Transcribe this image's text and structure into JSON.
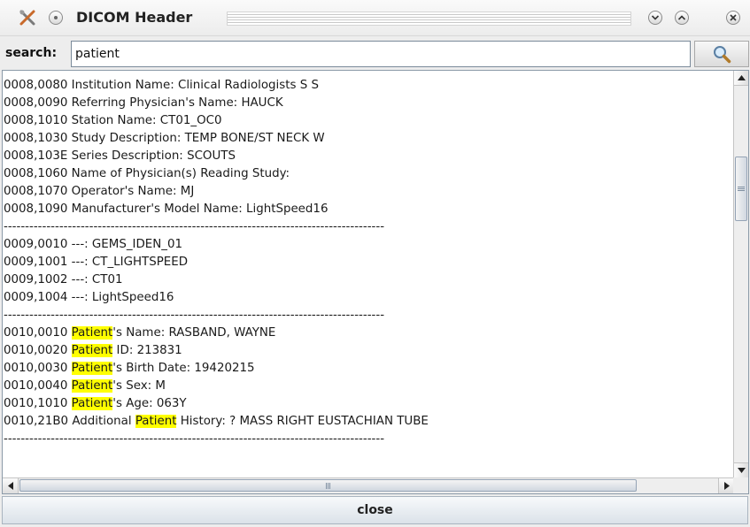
{
  "window": {
    "title": "DICOM Header"
  },
  "search": {
    "label": "search:",
    "value": "patient"
  },
  "content": {
    "highlight_color": "#ffff00",
    "lines": [
      [
        {
          "t": "0008,0080 Institution Name: Clinical Radiologists S S"
        }
      ],
      [
        {
          "t": "0008,0090 Referring Physician's Name: HAUCK"
        }
      ],
      [
        {
          "t": "0008,1010 Station Name: CT01_OC0"
        }
      ],
      [
        {
          "t": "0008,1030 Study Description: TEMP BONE/ST NECK W"
        }
      ],
      [
        {
          "t": "0008,103E Series Description: SCOUTS"
        }
      ],
      [
        {
          "t": "0008,1060 Name of Physician(s) Reading Study:"
        }
      ],
      [
        {
          "t": "0008,1070 Operator's Name: MJ"
        }
      ],
      [
        {
          "t": "0008,1090 Manufacturer's Model Name: LightSpeed16"
        }
      ],
      [
        {
          "t": "-----------------------------------------------------------------------------------------"
        }
      ],
      [
        {
          "t": "0009,0010 ---: GEMS_IDEN_01"
        }
      ],
      [
        {
          "t": "0009,1001 ---: CT_LIGHTSPEED"
        }
      ],
      [
        {
          "t": "0009,1002 ---: CT01"
        }
      ],
      [
        {
          "t": "0009,1004 ---: LightSpeed16"
        }
      ],
      [
        {
          "t": "-----------------------------------------------------------------------------------------"
        }
      ],
      [
        {
          "t": "0010,0010 "
        },
        {
          "t": "Patient",
          "hl": true
        },
        {
          "t": "'s Name: RASBAND, WAYNE"
        }
      ],
      [
        {
          "t": "0010,0020 "
        },
        {
          "t": "Patient",
          "hl": true
        },
        {
          "t": " ID: 213831"
        }
      ],
      [
        {
          "t": "0010,0030 "
        },
        {
          "t": "Patient",
          "hl": true
        },
        {
          "t": "'s Birth Date: 19420215"
        }
      ],
      [
        {
          "t": "0010,0040 "
        },
        {
          "t": "Patient",
          "hl": true
        },
        {
          "t": "'s Sex: M"
        }
      ],
      [
        {
          "t": "0010,1010 "
        },
        {
          "t": "Patient",
          "hl": true
        },
        {
          "t": "'s Age: 063Y"
        }
      ],
      [
        {
          "t": "0010,21B0 Additional "
        },
        {
          "t": "Patient",
          "hl": true
        },
        {
          "t": " History: ? MASS RIGHT EUSTACHIAN TUBE"
        }
      ],
      [
        {
          "t": "-----------------------------------------------------------------------------------------"
        }
      ]
    ]
  },
  "scrollbars": {
    "vertical_position": 0.22,
    "horizontal_position": 0.0
  },
  "buttons": {
    "close_label": "close"
  },
  "icons": {
    "app": "tools-icon",
    "window_menu": "window-menu-icon",
    "minimize": "chevron-down-icon",
    "maximize": "chevron-up-icon",
    "close": "close-icon",
    "search": "magnifier-icon"
  }
}
